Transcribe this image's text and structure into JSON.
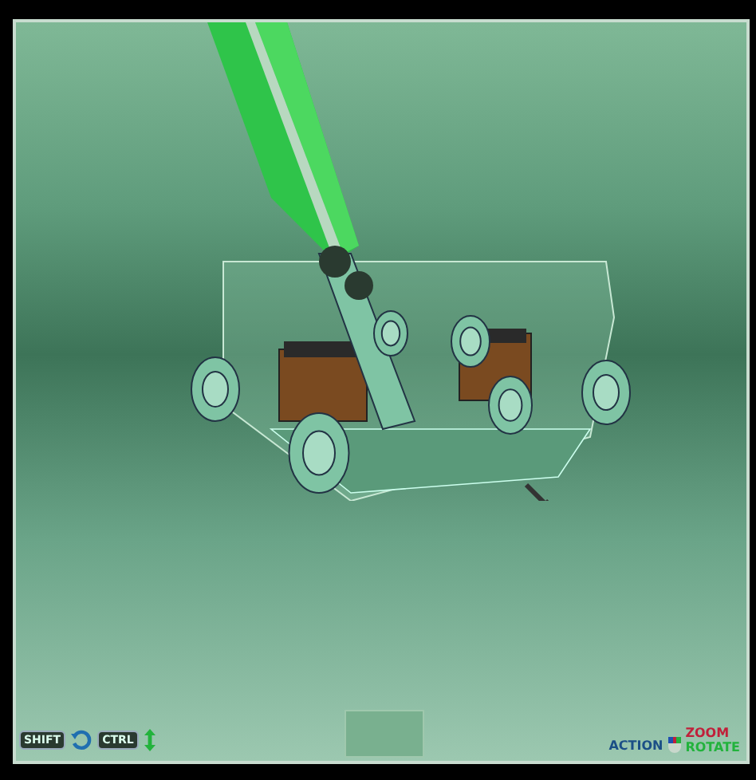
{
  "viewport": {
    "key_hints": [
      {
        "key": "SHIFT",
        "kind": "rotate"
      },
      {
        "key": "CTRL",
        "kind": "move"
      }
    ],
    "mouse_legend": {
      "action": "ACTION",
      "zoom": "ZOOM",
      "rotate": "ROTATE"
    }
  }
}
